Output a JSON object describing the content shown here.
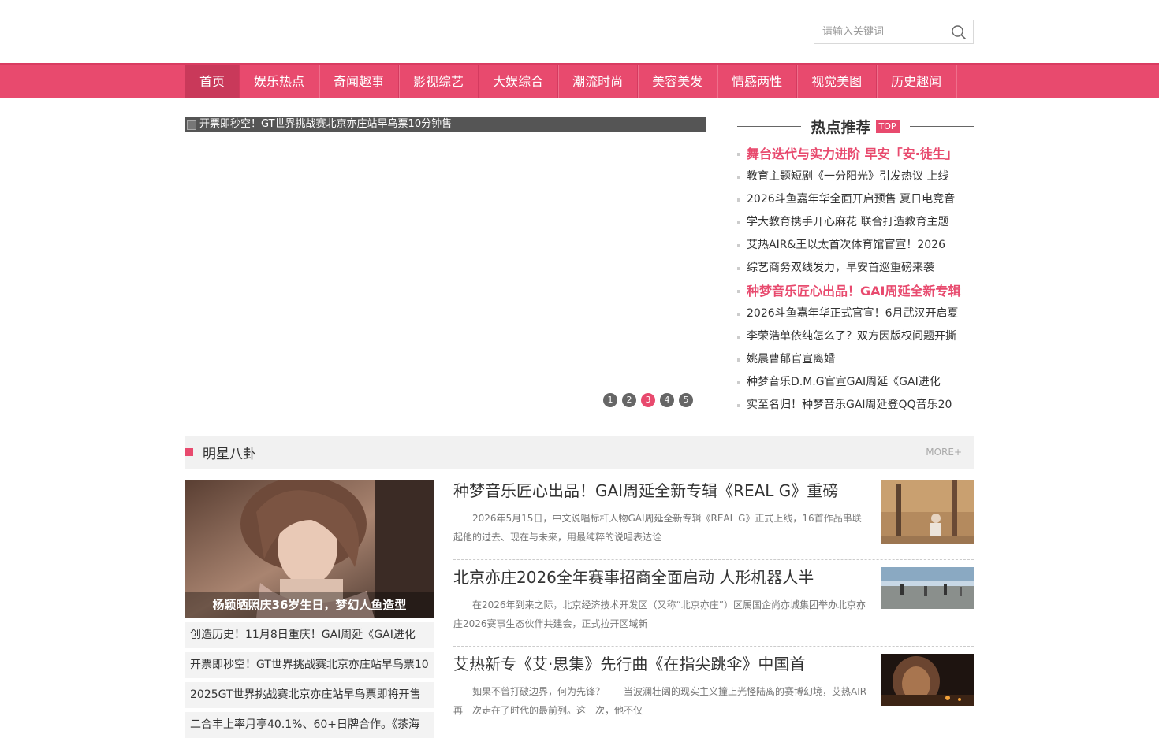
{
  "search": {
    "placeholder": "请输入关键词"
  },
  "nav": [
    "首页",
    "娱乐热点",
    "奇闻趣事",
    "影视综艺",
    "大娱综合",
    "潮流时尚",
    "美容美发",
    "情感两性",
    "视觉美图",
    "历史趣闻"
  ],
  "slider": {
    "caption": "开票即秒空！GT世界挑战赛北京亦庄站早鸟票10分钟售",
    "pages": [
      "1",
      "2",
      "3",
      "4",
      "5"
    ],
    "active_page": 3
  },
  "hot": {
    "title": "热点推荐",
    "badge": "TOP",
    "items": [
      "舞台迭代与实力进阶 早安「安·徒生」",
      "教育主题短剧《一分阳光》引发热议 上线",
      "2026斗鱼嘉年华全面开启预售 夏日电竞音",
      "学大教育携手开心麻花 联合打造教育主题",
      "艾热AIR&王以太首次体育馆官宣！2026",
      "综艺商务双线发力，早安首巡重磅来袭",
      "种梦音乐匠心出品！GAI周延全新专辑",
      "2026斗鱼嘉年华正式官宣！6月武汉开启夏",
      "李荣浩单依纯怎么了？双方因版权问题开撕",
      "姚晨曹郁官宣离婚",
      "种梦音乐D.M.G官宣GAI周延《GAI进化",
      "实至名归！种梦音乐GAI周延登QQ音乐20"
    ]
  },
  "section": {
    "title": "明星八卦",
    "more": "MORE+",
    "feature_caption": "杨颖晒照庆36岁生日，梦幻人鱼造型",
    "left_list": [
      "创造历史！11月8日重庆！GAI周延《GAI进化",
      "开票即秒空！GT世界挑战赛北京亦庄站早鸟票10",
      "2025GT世界挑战赛北京亦庄站早鸟票即将开售",
      "二合丰上率月亭40.1%、60+日牌合作。《茶海"
    ],
    "articles": [
      {
        "title": "种梦音乐匠心出品！GAI周延全新专辑《REAL G》重磅",
        "summary": "2026年5月15日，中文说唱标杆人物GAI周延全新专辑《REAL G》正式上线，16首作品串联起他的过去、现在与未来，用最纯粹的说唱表达诠"
      },
      {
        "title": "北京亦庄2026全年赛事招商全面启动 人形机器人半",
        "summary": "在2026年到来之际，北京经济技术开发区（又称“北京亦庄”）区属国企尚亦城集团举办北京亦庄2026赛事生态伙伴共建会，正式拉开区域新"
      },
      {
        "title": "艾热新专《艾·思集》先行曲《在指尖跳伞》中国首",
        "summary": "如果不曾打破边界，何为先锋？　　当波澜壮阔的现实主义撞上光怪陆离的赛博幻境，艾热AIR再一次走在了时代的最前列。这一次，他不仅"
      }
    ]
  },
  "colors": {
    "accent": "#e84a6e",
    "nav_bg": "#e84a6e"
  }
}
